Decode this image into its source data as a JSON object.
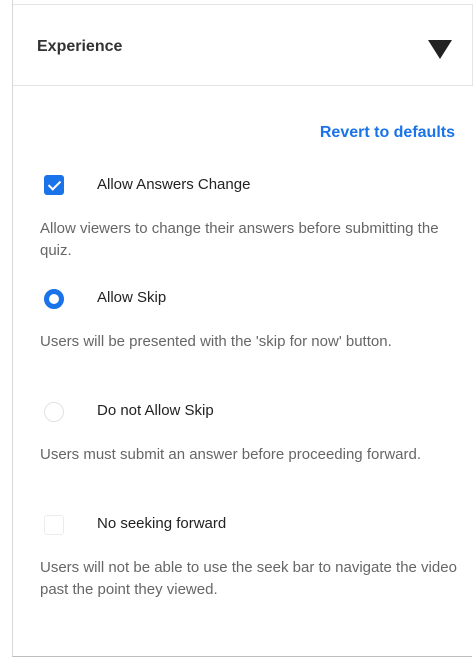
{
  "header": {
    "title": "Experience"
  },
  "revert_label": "Revert to defaults",
  "options": [
    {
      "control": "checkbox",
      "checked": true,
      "label": "Allow Answers Change",
      "description": "Allow viewers to change their answers before submitting the quiz."
    },
    {
      "control": "radio",
      "checked": true,
      "label": "Allow Skip",
      "description": "Users will be presented with the 'skip for now' button."
    },
    {
      "control": "radio",
      "checked": false,
      "label": "Do not Allow Skip",
      "description": "Users must submit an answer before proceeding forward."
    },
    {
      "control": "checkbox",
      "checked": false,
      "label": "No seeking forward",
      "description": "Users will not be able to use the seek bar to navigate the video past the point they viewed."
    }
  ],
  "colors": {
    "accent": "#1a73e8",
    "text": "#222222",
    "muted": "#666666"
  }
}
